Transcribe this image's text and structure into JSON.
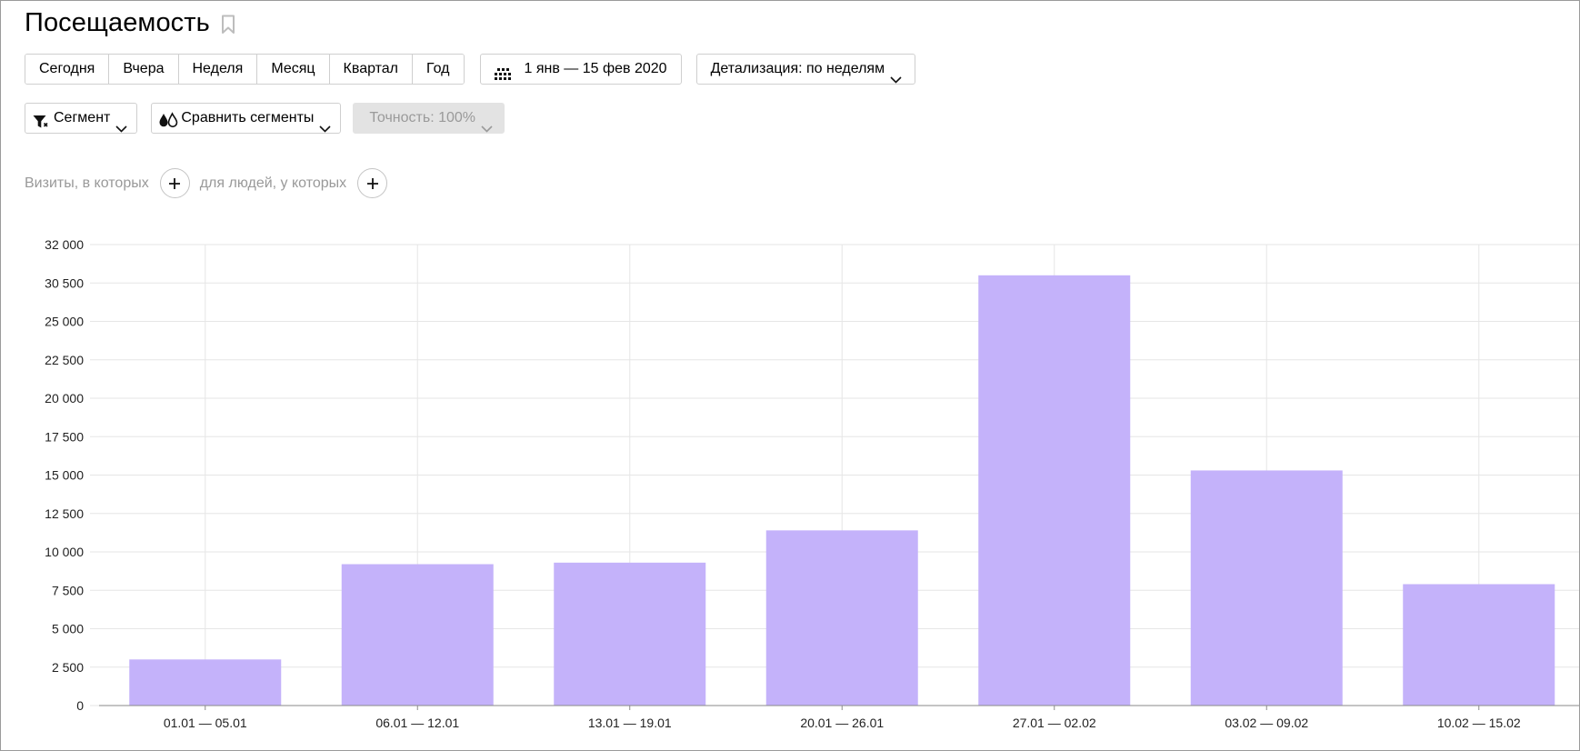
{
  "header": {
    "title": "Посещаемость"
  },
  "toolbar": {
    "periods": [
      "Сегодня",
      "Вчера",
      "Неделя",
      "Месяц",
      "Квартал",
      "Год"
    ],
    "date_range": "1 янв — 15 фев 2020",
    "detail_label": "Детализация: по неделям"
  },
  "segments": {
    "segment_label": "Сегмент",
    "compare_label": "Сравнить сегменты",
    "accuracy_label": "Точность: 100%"
  },
  "filters": {
    "visits_label": "Визиты, в которых",
    "people_label": "для людей, у которых"
  },
  "colors": {
    "bar": "#c4b2fa",
    "grid": "#e6e6e6",
    "axis": "#8a8a8a"
  },
  "chart_data": {
    "type": "bar",
    "categories": [
      "01.01 — 05.01",
      "06.01 — 12.01",
      "13.01 — 19.01",
      "20.01 — 26.01",
      "27.01 — 02.02",
      "03.02 — 09.02",
      "10.02 — 15.02"
    ],
    "values": [
      3000,
      9200,
      9300,
      11400,
      28000,
      15300,
      7900
    ],
    "yticks": [
      0,
      2500,
      5000,
      7500,
      10000,
      12500,
      15000,
      17500,
      20000,
      22500,
      25000,
      27500,
      30000
    ],
    "ytick_labels": [
      "0",
      "2 500",
      "5 000",
      "7 500",
      "10 000",
      "12 500",
      "15 000",
      "17 500",
      "20 000",
      "22 500",
      "25 000",
      "30 500",
      "32 000"
    ],
    "ylim": [
      0,
      30000
    ],
    "grid": true
  }
}
